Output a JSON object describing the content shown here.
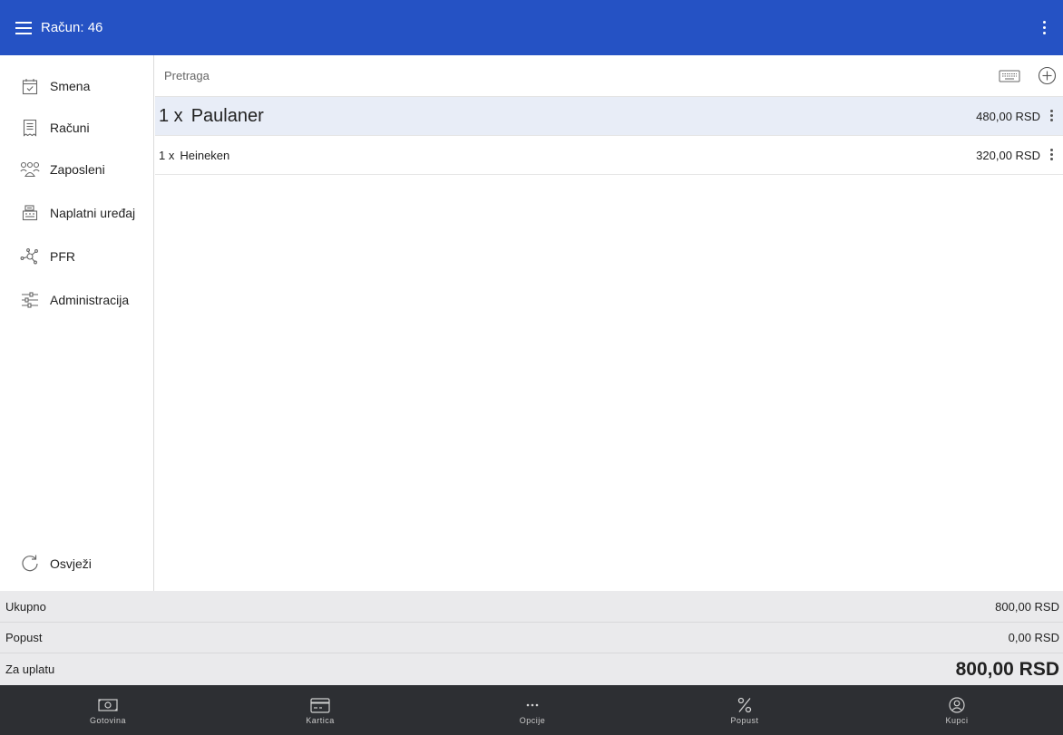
{
  "header": {
    "title": "Račun: 46",
    "menu_icon": "hamburger-menu-icon",
    "overflow_icon": "more-vert-icon"
  },
  "colors": {
    "primary": "#2552c4",
    "selected_row": "#e8edf7",
    "totals_bg": "#eaeaec",
    "bottom_bar": "#2d2f33"
  },
  "sidebar": {
    "items": [
      {
        "label": "Smena",
        "icon": "calendar-check-icon"
      },
      {
        "label": "Računi",
        "icon": "receipt-icon"
      },
      {
        "label": "Zaposleni",
        "icon": "people-icon"
      },
      {
        "label": "Naplatni uređaj",
        "icon": "cash-register-icon"
      },
      {
        "label": "PFR",
        "icon": "network-nodes-icon"
      },
      {
        "label": "Administracija",
        "icon": "sliders-icon"
      }
    ],
    "refresh": {
      "label": "Osvježi",
      "icon": "refresh-icon"
    }
  },
  "search": {
    "placeholder": "Pretraga",
    "value": "",
    "keyboard_icon": "keyboard-icon",
    "add_icon": "add-circle-icon"
  },
  "items": [
    {
      "qty": "1 x",
      "name": "Paulaner",
      "price": "480,00 RSD",
      "selected": true
    },
    {
      "qty": "1 x",
      "name": "Heineken",
      "price": "320,00 RSD",
      "selected": false
    }
  ],
  "totals": {
    "subtotal_label": "Ukupno",
    "subtotal_value": "800,00 RSD",
    "discount_label": "Popust",
    "discount_value": "0,00 RSD",
    "due_label": "Za uplatu",
    "due_value": "800,00 RSD"
  },
  "bottom_bar": [
    {
      "label": "Gotovina",
      "icon": "cash-icon"
    },
    {
      "label": "Kartica",
      "icon": "credit-card-icon"
    },
    {
      "label": "Opcije",
      "icon": "more-horiz-icon"
    },
    {
      "label": "Popust",
      "icon": "percent-icon"
    },
    {
      "label": "Kupci",
      "icon": "account-circle-icon"
    }
  ]
}
